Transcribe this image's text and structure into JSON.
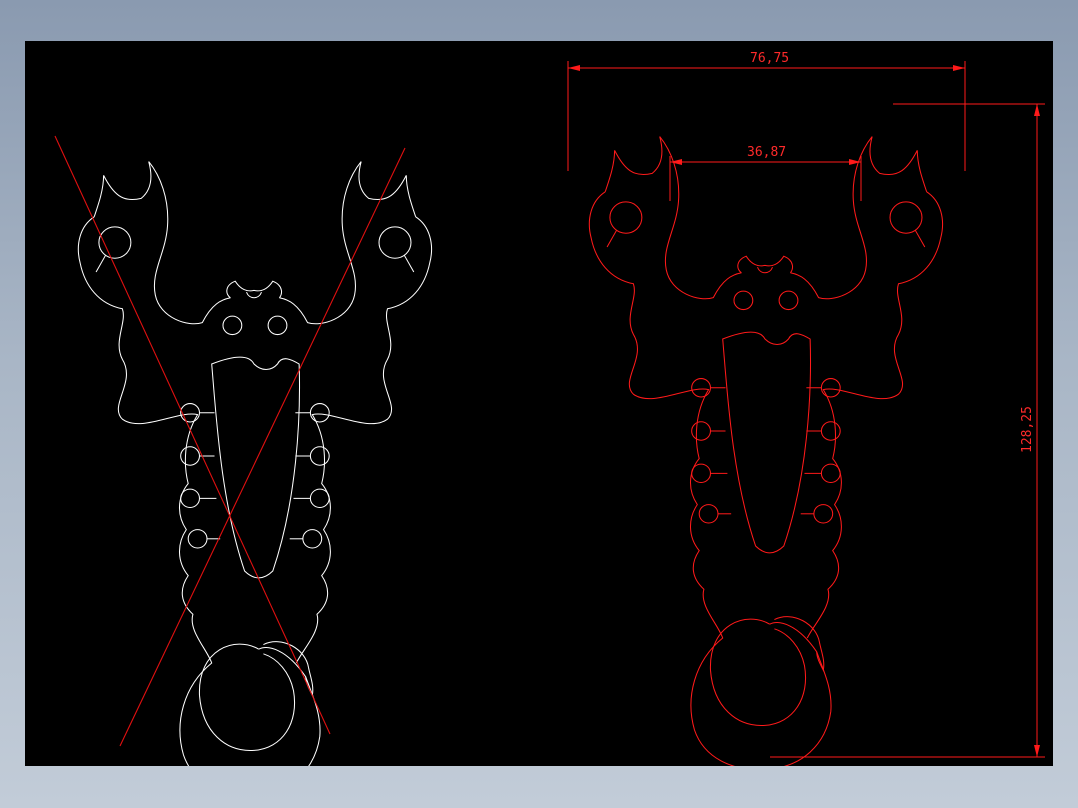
{
  "drawing": {
    "background": "#000000",
    "line_colors": {
      "left_view": "#ffffff",
      "right_view": "#ff1a1a",
      "cross_out": "#e01010"
    },
    "views": [
      "scorpion-outline-crossed",
      "scorpion-outline-dimensioned"
    ]
  },
  "dimensions": {
    "overall_width": "76,75",
    "inner_width": "36,87",
    "overall_height": "128,25"
  }
}
